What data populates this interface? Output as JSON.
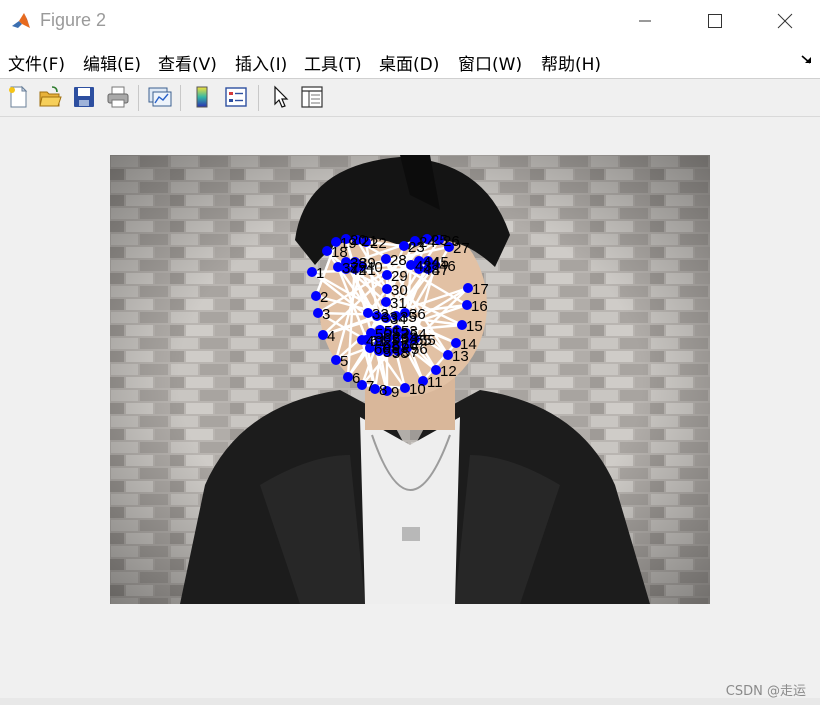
{
  "window": {
    "title": "Figure 2",
    "icon": "matlab-logo-icon"
  },
  "menubar": {
    "items": [
      "文件(F)",
      "编辑(E)",
      "查看(V)",
      "插入(I)",
      "工具(T)",
      "桌面(D)",
      "窗口(W)",
      "帮助(H)"
    ]
  },
  "toolbar": {
    "buttons": [
      {
        "name": "new-figure-icon"
      },
      {
        "name": "open-file-icon"
      },
      {
        "name": "save-icon"
      },
      {
        "name": "print-icon"
      },
      {
        "name": "link-plot-icon"
      },
      {
        "name": "insert-colorbar-icon"
      },
      {
        "name": "insert-legend-icon"
      },
      {
        "name": "edit-plot-arrow-icon"
      },
      {
        "name": "property-inspector-icon"
      }
    ]
  },
  "figure": {
    "marker_color": "#0000ff",
    "line_color": "#ffffff",
    "landmark_labels": [
      "1",
      "2",
      "3",
      "4",
      "5",
      "6",
      "7",
      "8",
      "9",
      "10",
      "11",
      "12",
      "13",
      "14",
      "15",
      "16",
      "17",
      "18",
      "19",
      "20",
      "21",
      "22",
      "23",
      "24",
      "25",
      "26",
      "27",
      "28",
      "29",
      "30",
      "31",
      "32",
      "33",
      "34",
      "35",
      "36",
      "37",
      "38",
      "39",
      "40",
      "41",
      "42",
      "43",
      "44",
      "45",
      "46",
      "47",
      "48",
      "49",
      "50",
      "51",
      "52",
      "53",
      "54",
      "55",
      "56",
      "57",
      "58",
      "59",
      "60",
      "61",
      "62",
      "63",
      "64",
      "65",
      "66",
      "67",
      "68"
    ]
  },
  "watermark": "CSDN @走运 "
}
